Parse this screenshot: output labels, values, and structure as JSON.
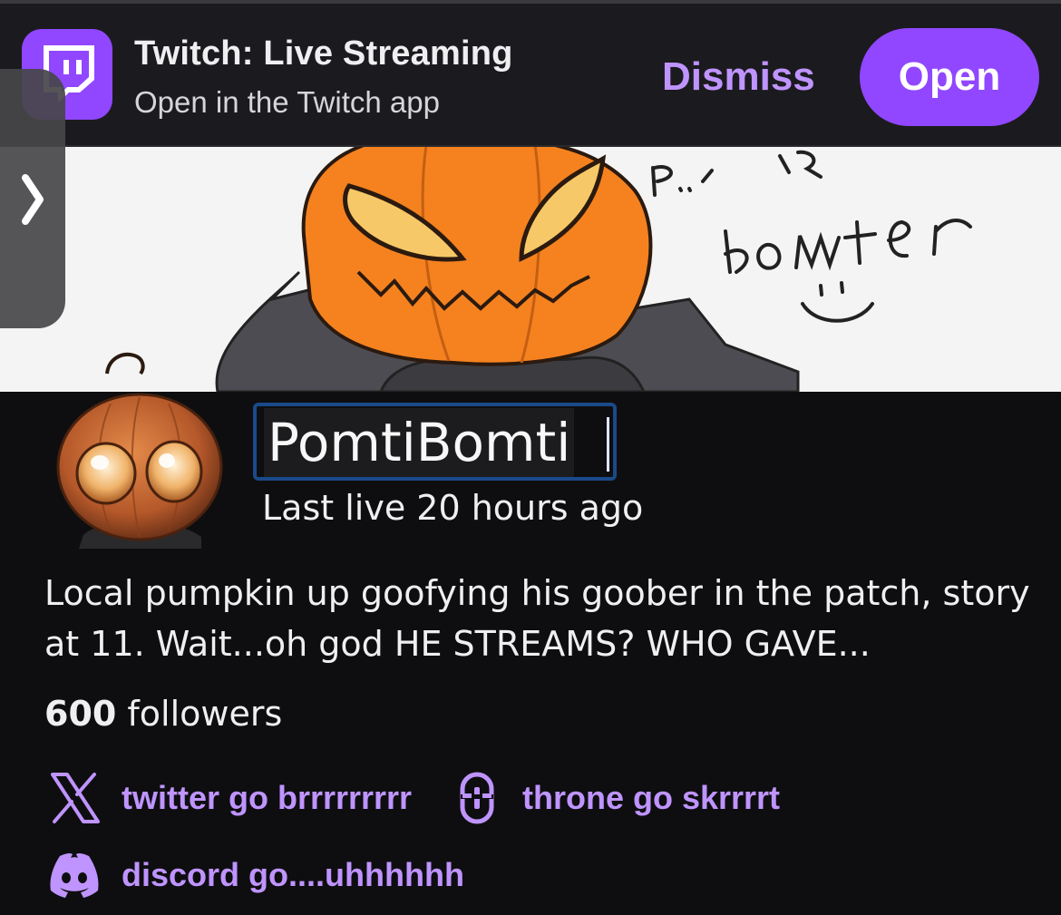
{
  "app_banner": {
    "title": "Twitch: Live Streaming",
    "subtitle": "Open in the Twitch app",
    "dismiss_label": "Dismiss",
    "open_label": "Open",
    "icon": "twitch-logo-icon"
  },
  "drawer": {
    "icon": "chevron-right-icon"
  },
  "banner_art": {
    "handwritten_text": "P...I Are bomter"
  },
  "channel": {
    "name": "PomtiBomti",
    "last_live": "Last live 20 hours ago",
    "bio": "Local pumpkin up goofying his goober in the patch, story at 11. Wait...oh god HE STREAMS? WHO GAVE...",
    "followers_count": "600",
    "followers_label": " followers"
  },
  "links": [
    {
      "label": "twitter go brrrrrrrrr",
      "icon": "x-twitter-icon"
    },
    {
      "label": "throne go skrrrrt",
      "icon": "throne-icon"
    },
    {
      "label": "discord go....uhhhhhh",
      "icon": "discord-icon"
    }
  ],
  "colors": {
    "accent": "#9147ff",
    "link": "#bf94ff",
    "background": "#0e0e10",
    "banner_bg": "#1b1b1f"
  }
}
